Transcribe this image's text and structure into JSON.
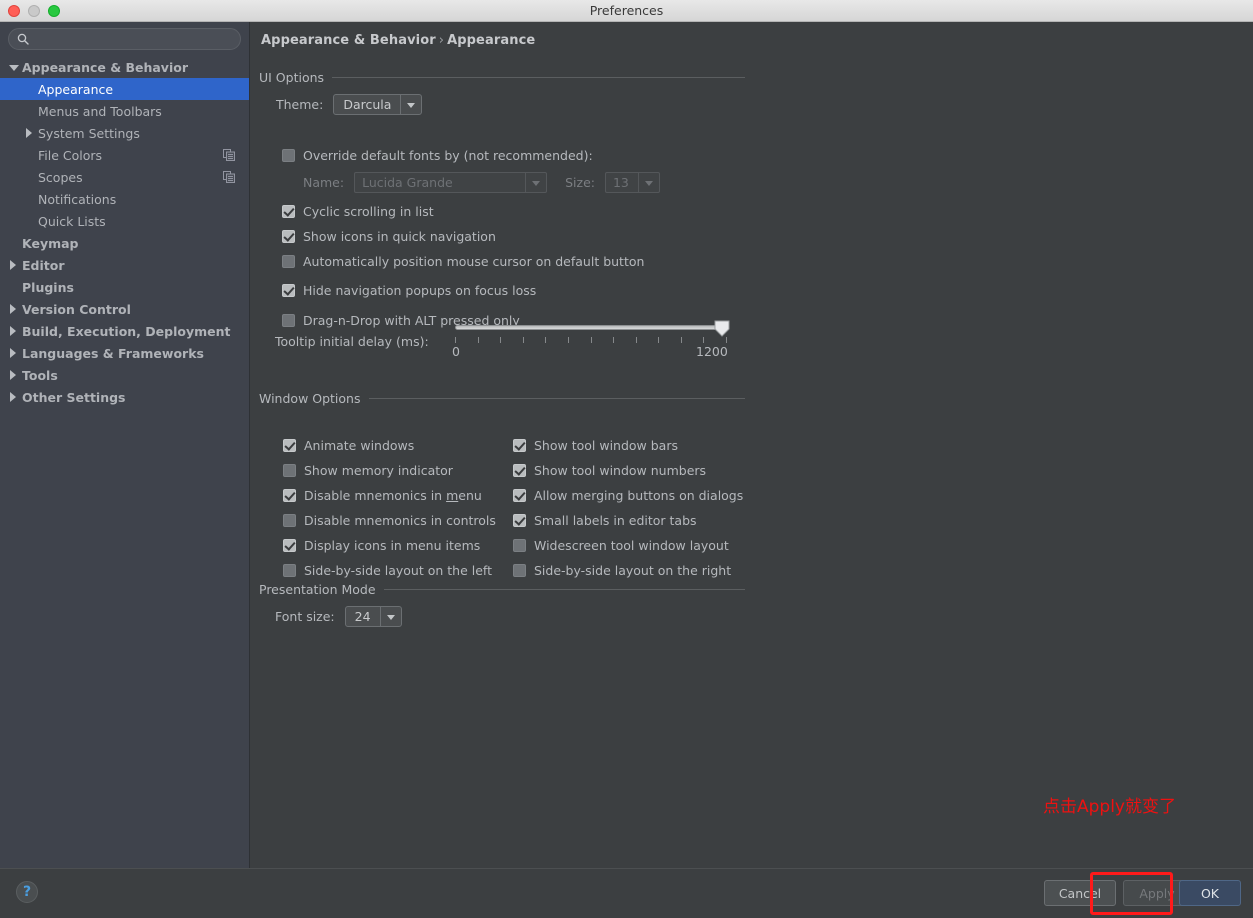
{
  "window": {
    "title": "Preferences",
    "traffic_lights": [
      "close-button",
      "minimize-button",
      "maximize-button"
    ]
  },
  "sidebar": {
    "search": {
      "value": "",
      "placeholder": "",
      "icon": "search-icon"
    },
    "items": [
      {
        "label": "Appearance & Behavior",
        "indent": 8,
        "arrow": "down",
        "bold": true,
        "selected": false,
        "badge": null
      },
      {
        "label": "Appearance",
        "indent": 38,
        "arrow": "none",
        "bold": false,
        "selected": true,
        "badge": null
      },
      {
        "label": "Menus and Toolbars",
        "indent": 38,
        "arrow": "none",
        "bold": false,
        "selected": false,
        "badge": null
      },
      {
        "label": "System Settings",
        "indent": 24,
        "arrow": "right",
        "bold": false,
        "selected": false,
        "badge": null
      },
      {
        "label": "File Colors",
        "indent": 38,
        "arrow": "none",
        "bold": false,
        "selected": false,
        "badge": "copy-icon"
      },
      {
        "label": "Scopes",
        "indent": 38,
        "arrow": "none",
        "bold": false,
        "selected": false,
        "badge": "copy-icon"
      },
      {
        "label": "Notifications",
        "indent": 38,
        "arrow": "none",
        "bold": false,
        "selected": false,
        "badge": null
      },
      {
        "label": "Quick Lists",
        "indent": 38,
        "arrow": "none",
        "bold": false,
        "selected": false,
        "badge": null
      },
      {
        "label": "Keymap",
        "indent": 22,
        "arrow": "none",
        "bold": true,
        "selected": false,
        "badge": null
      },
      {
        "label": "Editor",
        "indent": 8,
        "arrow": "right",
        "bold": true,
        "selected": false,
        "badge": null
      },
      {
        "label": "Plugins",
        "indent": 22,
        "arrow": "none",
        "bold": true,
        "selected": false,
        "badge": null
      },
      {
        "label": "Version Control",
        "indent": 8,
        "arrow": "right",
        "bold": true,
        "selected": false,
        "badge": null
      },
      {
        "label": "Build, Execution, Deployment",
        "indent": 8,
        "arrow": "right",
        "bold": true,
        "selected": false,
        "badge": null
      },
      {
        "label": "Languages & Frameworks",
        "indent": 8,
        "arrow": "right",
        "bold": true,
        "selected": false,
        "badge": null
      },
      {
        "label": "Tools",
        "indent": 8,
        "arrow": "right",
        "bold": true,
        "selected": false,
        "badge": null
      },
      {
        "label": "Other Settings",
        "indent": 8,
        "arrow": "right",
        "bold": true,
        "selected": false,
        "badge": null
      }
    ]
  },
  "breadcrumb": {
    "root": "Appearance & Behavior",
    "separator": "›",
    "current": "Appearance"
  },
  "ui_options": {
    "section_title": "UI Options",
    "theme_label": "Theme:",
    "theme_value": "Darcula",
    "override_fonts_label": "Override default fonts by (not recommended):",
    "override_fonts_checked": false,
    "font_name_label": "Name:",
    "font_name_value": "Lucida Grande",
    "font_size_label": "Size:",
    "font_size_value": "13",
    "checkboxes": [
      {
        "label": "Cyclic scrolling in list",
        "checked": true
      },
      {
        "label": "Show icons in quick navigation",
        "checked": true
      },
      {
        "label": "Automatically position mouse cursor on default button",
        "checked": false
      },
      {
        "label": "Hide navigation popups on focus loss",
        "checked": true
      },
      {
        "label": "Drag-n-Drop with ALT pressed only",
        "checked": false
      }
    ],
    "tooltip_delay": {
      "label": "Tooltip initial delay (ms):",
      "min_label": "0",
      "max_label": "1200",
      "min": 0,
      "max": 1200,
      "value": 1200,
      "tick_count": 13
    }
  },
  "window_options": {
    "section_title": "Window Options",
    "left_column": [
      {
        "label": "Animate windows",
        "checked": true,
        "mnemonic": ""
      },
      {
        "label": "Show memory indicator",
        "checked": false,
        "mnemonic": ""
      },
      {
        "label": "Disable mnemonics in menu",
        "checked": true,
        "mnemonic": "m"
      },
      {
        "label": "Disable mnemonics in controls",
        "checked": false,
        "mnemonic": ""
      },
      {
        "label": "Display icons in menu items",
        "checked": true,
        "mnemonic": ""
      },
      {
        "label": "Side-by-side layout on the left",
        "checked": false,
        "mnemonic": ""
      }
    ],
    "right_column": [
      {
        "label": "Show tool window bars",
        "checked": true
      },
      {
        "label": "Show tool window numbers",
        "checked": true
      },
      {
        "label": "Allow merging buttons on dialogs",
        "checked": true
      },
      {
        "label": "Small labels in editor tabs",
        "checked": true
      },
      {
        "label": "Widescreen tool window layout",
        "checked": false
      },
      {
        "label": "Side-by-side layout on the right",
        "checked": false
      }
    ]
  },
  "presentation_mode": {
    "section_title": "Presentation Mode",
    "font_size_label": "Font size:",
    "font_size_value": "24"
  },
  "footer": {
    "help_label": "?",
    "cancel_label": "Cancel",
    "apply_label": "Apply",
    "ok_label": "OK"
  },
  "annotation": {
    "text": "点击Apply就变了",
    "color": "#ee1111",
    "highlight_target": "apply-button"
  },
  "colors": {
    "selection_blue": "#2f65ca",
    "sidebar_bg": "#3f434c",
    "panel_bg": "#3c3f41",
    "default_button_blue": "#3a4a63",
    "annotation_red": "#ff1a1a"
  }
}
